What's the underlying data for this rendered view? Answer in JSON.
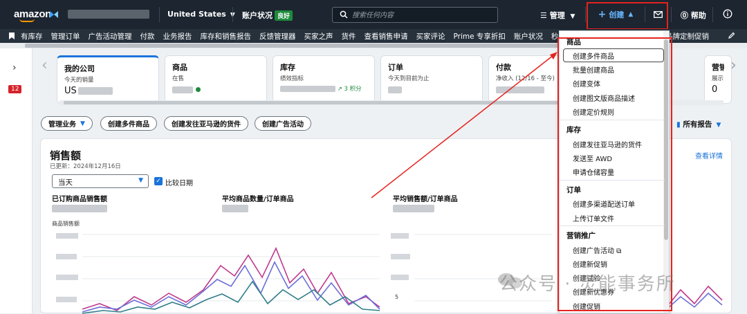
{
  "topbar": {
    "logo": "amazon",
    "marketplace": "United States",
    "health_label": "账户状况",
    "health_badge": "良好",
    "search_placeholder": "搜索任何内容",
    "manage_label": "管理",
    "create_label": "创建",
    "help_label": "帮助"
  },
  "nav": {
    "items": [
      "有库存",
      "管理订单",
      "广告活动管理",
      "付款",
      "业务报告",
      "库存和销售报告",
      "反馈管理器",
      "买家之声",
      "货件",
      "查看销售申请",
      "买家评论",
      "Prime 专享折扣",
      "账户状况",
      "秒杀"
    ],
    "right_item": "品牌定制促销"
  },
  "rail": {
    "badge": "12"
  },
  "cards": [
    {
      "title": "我的公司",
      "sub": "今天的销量",
      "value": "US"
    },
    {
      "title": "商品",
      "sub": "在售",
      "value": ""
    },
    {
      "title": "库存",
      "sub": "绩效指标",
      "value": "3 积分"
    },
    {
      "title": "订单",
      "sub": "今天到目前为止",
      "value": ""
    },
    {
      "title": "付款",
      "sub": "净收入 (12/16 - 至今)",
      "value": ""
    },
    {
      "title": "营销",
      "sub": "展示",
      "value": "0"
    }
  ],
  "actions": {
    "manage_business": "管理业务",
    "create_multi": "创建多件商品",
    "create_shipment": "创建发往亚马逊的货件",
    "create_campaign": "创建广告活动",
    "all_reports": "所有报告"
  },
  "panel": {
    "title": "销售额",
    "updated": "已更新：2024年12月16日",
    "view_details": "查看详情",
    "period": "当天",
    "compare_label": "比较日期",
    "metrics": [
      "已订购商品销售额",
      "平均商品数量/订单商品",
      "平均销售额/订单商品"
    ],
    "sub_label": "商品销售额",
    "right_axis_tick": "5"
  },
  "dropdown": {
    "sections": [
      {
        "header": "商品",
        "items": [
          "创建多件商品",
          "批量创建商品",
          "创建变体",
          "创建图文版商品描述",
          "创建定价规则"
        ]
      },
      {
        "header": "库存",
        "items": [
          "创建发往亚马逊的货件",
          "发送至 AWD",
          "申请仓储容量"
        ]
      },
      {
        "header": "订单",
        "items": [
          "创建多渠道配送订单",
          "上传订单文件"
        ]
      },
      {
        "header": "营销推广",
        "items": [
          "创建广告活动",
          "创建新促销",
          "创建试验",
          "创建新优惠券",
          "创建促销"
        ]
      }
    ]
  },
  "watermark": "公众号 · 灵能事务所",
  "colors": {
    "accent": "#1a73d9",
    "annotation": "#e5231e",
    "topbar": "#1c2530"
  }
}
